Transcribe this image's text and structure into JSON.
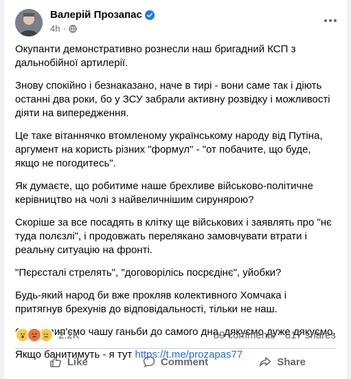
{
  "post": {
    "author": "Валерій Прозапас",
    "time": "4h",
    "paragraphs": [
      "Окупанти демонстративно рознесли наш бригадний КСП з дальнобійної артилерії.",
      "Знову спокійно і безнаказано,  наче в тирі - вони саме так і діють останні два роки, бо у ЗСУ забрали активну  розвідку і можливості діяти на випередження.",
      "Це таке вітаннячко втомленому українському народу від Путіна, аргумент на користь різних \"формул\" - \"от побачите, що буде, якщо не погодитесь\".",
      "Як думаєте, що робитиме наше брехливе військово-політичне керівництво на чолі з найвеличнішим сирунярою?",
      "Скоріше за все посадять в клітку ще військових і заявлять про \"нє туда полєзлі\", і продовжать переляканo замовчувати втрати і реальну ситуацію на фронті.",
      "\"Пєрєсталі стрелять\", \"договорілісь посрєдінє\", уйобки?",
      "Будь-який народ би вже прокляв колективного Хомчака і притягнув брехунів до відповідальності, тільки не наш.",
      "Схоже вип'ємо чашу ганьби до самого дна, дякуємо дуже дякуємо."
    ],
    "final_text": "Якщо банитимуть - я тут ",
    "link": "https://t.me/prozapas77"
  },
  "stats": {
    "reactions_count": "2.2K",
    "comments": "89 comments",
    "shares": "617 shares",
    "reaction_icons": [
      "wow-icon",
      "angry-icon",
      "sad-icon"
    ]
  },
  "actions": {
    "like": "Like",
    "comment": "Comment",
    "share": "Share"
  },
  "colors": {
    "link": "#216fdb",
    "verified": "#1877f2",
    "angry": "#f0743a",
    "sad": "#f7c948"
  }
}
